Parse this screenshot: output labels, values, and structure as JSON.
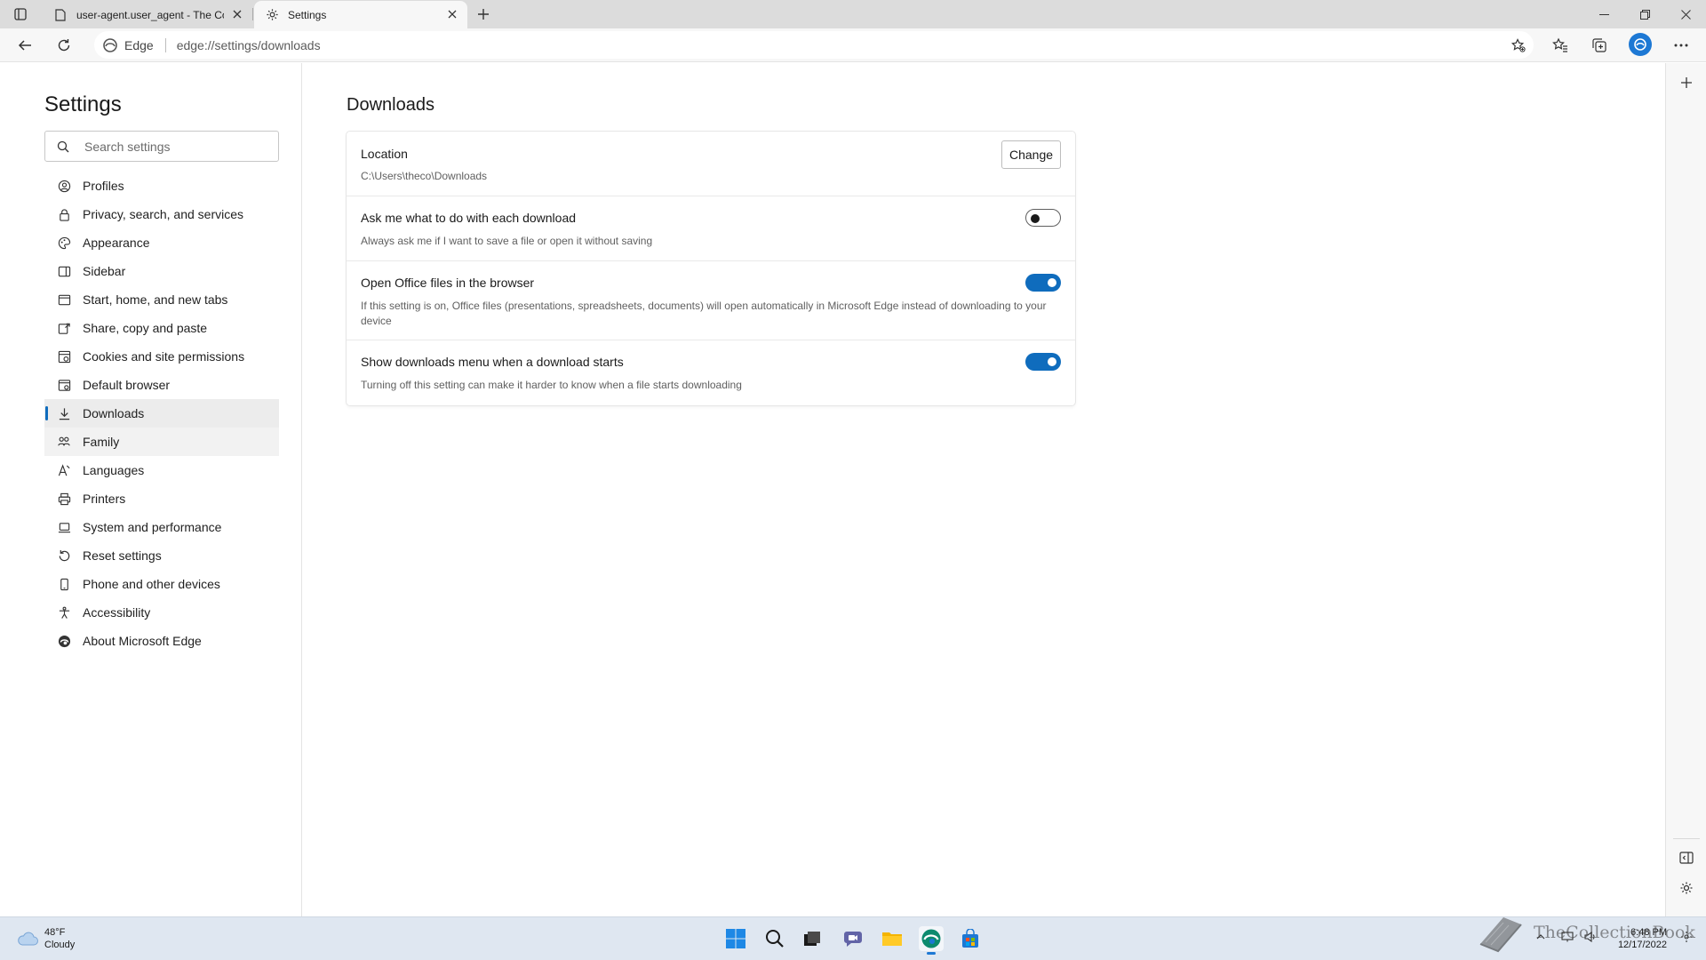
{
  "browser": {
    "tabs": [
      {
        "title": "user-agent.user_agent - The Coll",
        "icon": "document-icon"
      },
      {
        "title": "Settings",
        "icon": "gear-icon"
      }
    ],
    "address_label": "Edge",
    "url": "edge://settings/downloads"
  },
  "settings": {
    "title": "Settings",
    "search_placeholder": "Search settings",
    "nav": [
      {
        "label": "Profiles",
        "icon": "profile-icon"
      },
      {
        "label": "Privacy, search, and services",
        "icon": "lock-icon"
      },
      {
        "label": "Appearance",
        "icon": "appearance-icon"
      },
      {
        "label": "Sidebar",
        "icon": "sidebar-icon"
      },
      {
        "label": "Start, home, and new tabs",
        "icon": "home-icon"
      },
      {
        "label": "Share, copy and paste",
        "icon": "share-icon"
      },
      {
        "label": "Cookies and site permissions",
        "icon": "cookie-icon"
      },
      {
        "label": "Default browser",
        "icon": "browser-icon"
      },
      {
        "label": "Downloads",
        "icon": "download-icon"
      },
      {
        "label": "Family",
        "icon": "family-icon"
      },
      {
        "label": "Languages",
        "icon": "language-icon"
      },
      {
        "label": "Printers",
        "icon": "printer-icon"
      },
      {
        "label": "System and performance",
        "icon": "laptop-icon"
      },
      {
        "label": "Reset settings",
        "icon": "reset-icon"
      },
      {
        "label": "Phone and other devices",
        "icon": "phone-icon"
      },
      {
        "label": "Accessibility",
        "icon": "accessibility-icon"
      },
      {
        "label": "About Microsoft Edge",
        "icon": "edge-icon"
      }
    ],
    "selected": "Downloads"
  },
  "downloads": {
    "title": "Downloads",
    "location": {
      "title": "Location",
      "path": "C:\\Users\\theco\\Downloads",
      "button": "Change"
    },
    "ask": {
      "title": "Ask me what to do with each download",
      "desc": "Always ask me if I want to save a file or open it without saving",
      "enabled": false
    },
    "office": {
      "title": "Open Office files in the browser",
      "desc": "If this setting is on, Office files (presentations, spreadsheets, documents) will open automatically in Microsoft Edge instead of downloading to your device",
      "enabled": true
    },
    "menu": {
      "title": "Show downloads menu when a download starts",
      "desc": "Turning off this setting can make it harder to know when a file starts downloading",
      "enabled": true
    }
  },
  "taskbar": {
    "weather_temp": "48°F",
    "weather_cond": "Cloudy",
    "time": "6:48 PM",
    "date": "12/17/2022",
    "watermark": "TheCollectionBook"
  },
  "colors": {
    "accent": "#0f6cbd",
    "taskbar": "#dfe7f1"
  }
}
